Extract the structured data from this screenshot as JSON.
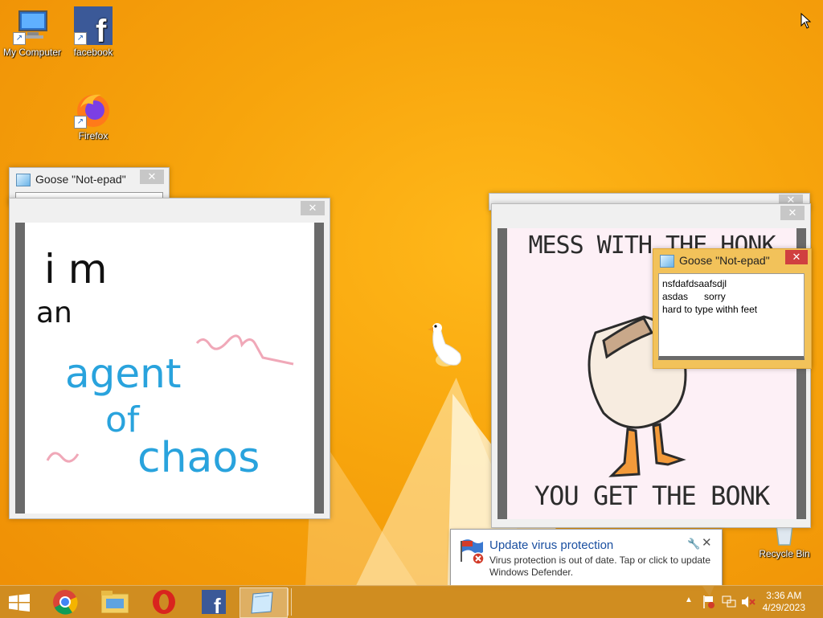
{
  "desktop": {
    "icons": [
      {
        "label": "My Computer"
      },
      {
        "label": "facebook"
      },
      {
        "label": "Firefox"
      },
      {
        "label": "Recycle Bin"
      }
    ]
  },
  "windows": {
    "notepad_back": {
      "title": "Goose \"Not-epad\""
    },
    "notepad_front": {
      "title": "Goose \"Not-epad\"",
      "lines": [
        "nsfdafdsaafsdjl",
        "asdas      sorry",
        "hard to type withh feet"
      ]
    },
    "drawing": {
      "words": [
        "i m",
        "an",
        "agent",
        "of",
        "chaos"
      ]
    },
    "meme": {
      "top_text": "MESS WITH THE HONK",
      "bottom_text": "YOU GET THE BONK"
    }
  },
  "notification": {
    "title": "Update virus protection",
    "body": "Virus protection is out of date. Tap or click to update Windows Defender."
  },
  "taskbar": {
    "apps": [
      "start",
      "chrome",
      "file-explorer",
      "opera",
      "facebook",
      "notepad"
    ],
    "clock_time": "3:36 AM",
    "clock_date": "4/29/2023"
  },
  "colors": {
    "accent": "#f7a40c",
    "taskbar": "#cd8c23",
    "notepad_border": "#e8b84a"
  }
}
